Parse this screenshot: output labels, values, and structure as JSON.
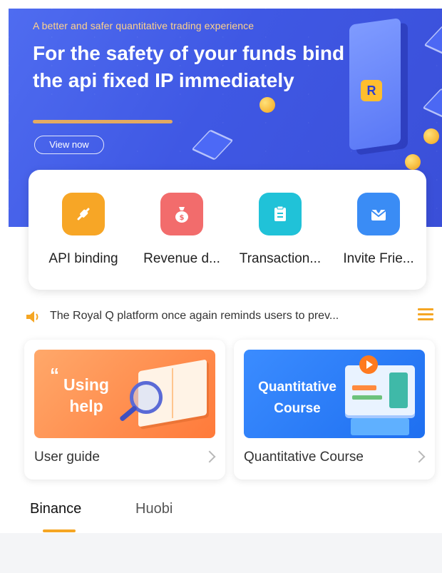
{
  "banner": {
    "subtitle": "A better and safer quantitative trading experience",
    "headline": "For the safety of  your funds bind the api fixed IP immediately",
    "cta_label": "View now",
    "logo_letter": "R"
  },
  "quick_actions": [
    {
      "label": "API binding",
      "icon": "plug-icon",
      "color": "#f7a626"
    },
    {
      "label": "Revenue d...",
      "icon": "money-bag-icon",
      "color": "#f26c6c"
    },
    {
      "label": "Transaction...",
      "icon": "clipboard-icon",
      "color": "#20c2d8"
    },
    {
      "label": "Invite Frie...",
      "icon": "envelope-heart-icon",
      "color": "#3a8cf5"
    }
  ],
  "notice": {
    "text": "The Royal Q platform once again reminds users to prev...",
    "icon": "speaker-icon",
    "menu_icon": "menu-icon"
  },
  "guides": [
    {
      "image_text": "Using help",
      "quote": "“",
      "caption": "User guide"
    },
    {
      "image_text": "Quantitative Course",
      "caption": "Quantitative Course"
    }
  ],
  "exchange_tabs": [
    {
      "label": "Binance",
      "active": true
    },
    {
      "label": "Huobi",
      "active": false
    }
  ],
  "colors": {
    "banner": "#4560ea",
    "accent": "#f5a623"
  }
}
